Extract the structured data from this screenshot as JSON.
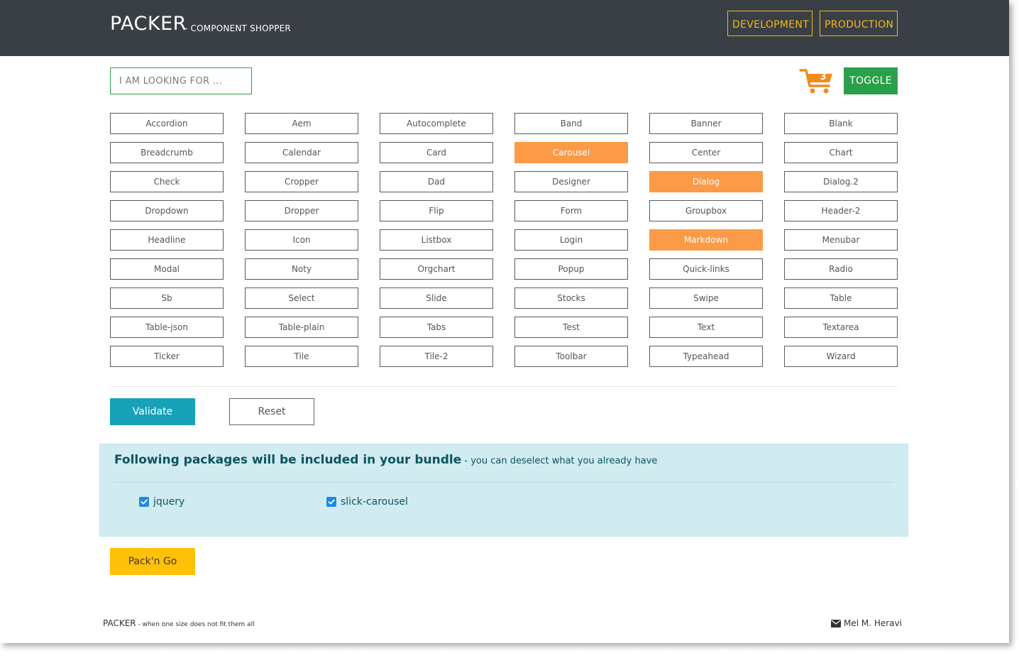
{
  "header": {
    "brand": "PACKER",
    "subtitle": "- COMPONENT SHOPPER",
    "env_buttons": [
      "DEVELOPMENT",
      "PRODUCTION"
    ],
    "accent_color": "#f5b91a"
  },
  "toolbar": {
    "search_placeholder": "I AM LOOKING FOR ...",
    "cart_count": "3",
    "toggle_label": "TOGGLE",
    "cart_icon": "shopping-cart-icon"
  },
  "components": [
    "Accordion",
    "Aem",
    "Autocomplete",
    "Band",
    "Banner",
    "Blank",
    "Breadcrumb",
    "Calendar",
    "Card",
    "Carousel",
    "Center",
    "Chart",
    "Check",
    "Cropper",
    "Dad",
    "Designer",
    "Dialog",
    "Dialog.2",
    "Dropdown",
    "Dropper",
    "Flip",
    "Form",
    "Groupbox",
    "Header-2",
    "Headline",
    "Icon",
    "Listbox",
    "Login",
    "Markdown",
    "Menubar",
    "Modal",
    "Noty",
    "Orgchart",
    "Popup",
    "Quick-links",
    "Radio",
    "Sb",
    "Select",
    "Slide",
    "Stocks",
    "Swipe",
    "Table",
    "Table-json",
    "Table-plain",
    "Tabs",
    "Test",
    "Text",
    "Textarea",
    "Ticker",
    "Tile",
    "Tile-2",
    "Toolbar",
    "Typeahead",
    "Wizard"
  ],
  "selected_components": [
    "Carousel",
    "Dialog",
    "Markdown"
  ],
  "selected_color": "#fb9a47",
  "actions": {
    "validate_label": "Validate",
    "reset_label": "Reset",
    "pack_label": "Pack'n Go"
  },
  "bundle": {
    "title": "Following packages will be included in your bundle",
    "subtitle": " - you can deselect what you already have",
    "packages": [
      {
        "name": "jquery",
        "checked": true
      },
      {
        "name": "slick-carousel",
        "checked": true
      }
    ]
  },
  "footer": {
    "brand": "PACKER",
    "tagline": " - when one size does not fit them all",
    "author": "Mel M. Heravi",
    "author_icon": "envelope-icon"
  }
}
